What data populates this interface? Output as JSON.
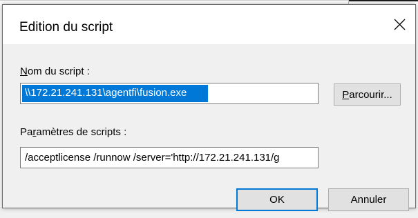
{
  "dialog": {
    "title": "Edition du script",
    "close_icon": "close-icon"
  },
  "script_name": {
    "label_accel": "N",
    "label_rest": "om du script :",
    "value": "\\\\172.21.241.131\\agentfi\\fusion.exe",
    "selected": true
  },
  "browse_button": {
    "label_accel": "P",
    "label_rest": "arcourir..."
  },
  "script_params": {
    "label_pre": "Pa",
    "label_accel": "r",
    "label_rest": "amètres de scripts :",
    "value": "/acceptlicense /runnow /server='http://172.21.241.131/g"
  },
  "buttons": {
    "ok": "OK",
    "cancel": "Annuler"
  },
  "colors": {
    "selection": "#0078d7",
    "default_button_border": "#0078d7",
    "dialog_bg": "#f0f0f0"
  }
}
